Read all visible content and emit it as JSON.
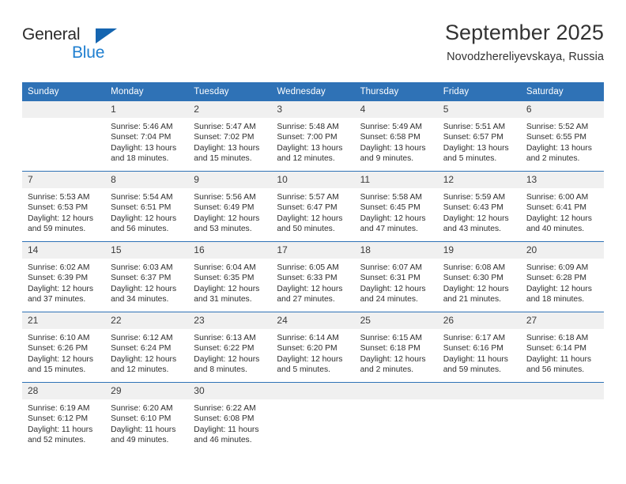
{
  "brand": {
    "name_part1": "General",
    "name_part2": "Blue",
    "triangle_color": "#1565b0",
    "blue_text_color": "#1f7fd0"
  },
  "header": {
    "title": "September 2025",
    "subtitle": "Novodzhereliyevskaya, Russia"
  },
  "theme": {
    "header_blue": "#2f72b6",
    "daynum_background": "#f0f0f0",
    "page_background": "#ffffff",
    "text_color": "#2e2e2e"
  },
  "weekdays": [
    "Sunday",
    "Monday",
    "Tuesday",
    "Wednesday",
    "Thursday",
    "Friday",
    "Saturday"
  ],
  "weeks": [
    [
      {
        "day": "",
        "sunrise": "",
        "sunset": "",
        "daylight1": "",
        "daylight2": ""
      },
      {
        "day": "1",
        "sunrise": "Sunrise: 5:46 AM",
        "sunset": "Sunset: 7:04 PM",
        "daylight1": "Daylight: 13 hours",
        "daylight2": "and 18 minutes."
      },
      {
        "day": "2",
        "sunrise": "Sunrise: 5:47 AM",
        "sunset": "Sunset: 7:02 PM",
        "daylight1": "Daylight: 13 hours",
        "daylight2": "and 15 minutes."
      },
      {
        "day": "3",
        "sunrise": "Sunrise: 5:48 AM",
        "sunset": "Sunset: 7:00 PM",
        "daylight1": "Daylight: 13 hours",
        "daylight2": "and 12 minutes."
      },
      {
        "day": "4",
        "sunrise": "Sunrise: 5:49 AM",
        "sunset": "Sunset: 6:58 PM",
        "daylight1": "Daylight: 13 hours",
        "daylight2": "and 9 minutes."
      },
      {
        "day": "5",
        "sunrise": "Sunrise: 5:51 AM",
        "sunset": "Sunset: 6:57 PM",
        "daylight1": "Daylight: 13 hours",
        "daylight2": "and 5 minutes."
      },
      {
        "day": "6",
        "sunrise": "Sunrise: 5:52 AM",
        "sunset": "Sunset: 6:55 PM",
        "daylight1": "Daylight: 13 hours",
        "daylight2": "and 2 minutes."
      }
    ],
    [
      {
        "day": "7",
        "sunrise": "Sunrise: 5:53 AM",
        "sunset": "Sunset: 6:53 PM",
        "daylight1": "Daylight: 12 hours",
        "daylight2": "and 59 minutes."
      },
      {
        "day": "8",
        "sunrise": "Sunrise: 5:54 AM",
        "sunset": "Sunset: 6:51 PM",
        "daylight1": "Daylight: 12 hours",
        "daylight2": "and 56 minutes."
      },
      {
        "day": "9",
        "sunrise": "Sunrise: 5:56 AM",
        "sunset": "Sunset: 6:49 PM",
        "daylight1": "Daylight: 12 hours",
        "daylight2": "and 53 minutes."
      },
      {
        "day": "10",
        "sunrise": "Sunrise: 5:57 AM",
        "sunset": "Sunset: 6:47 PM",
        "daylight1": "Daylight: 12 hours",
        "daylight2": "and 50 minutes."
      },
      {
        "day": "11",
        "sunrise": "Sunrise: 5:58 AM",
        "sunset": "Sunset: 6:45 PM",
        "daylight1": "Daylight: 12 hours",
        "daylight2": "and 47 minutes."
      },
      {
        "day": "12",
        "sunrise": "Sunrise: 5:59 AM",
        "sunset": "Sunset: 6:43 PM",
        "daylight1": "Daylight: 12 hours",
        "daylight2": "and 43 minutes."
      },
      {
        "day": "13",
        "sunrise": "Sunrise: 6:00 AM",
        "sunset": "Sunset: 6:41 PM",
        "daylight1": "Daylight: 12 hours",
        "daylight2": "and 40 minutes."
      }
    ],
    [
      {
        "day": "14",
        "sunrise": "Sunrise: 6:02 AM",
        "sunset": "Sunset: 6:39 PM",
        "daylight1": "Daylight: 12 hours",
        "daylight2": "and 37 minutes."
      },
      {
        "day": "15",
        "sunrise": "Sunrise: 6:03 AM",
        "sunset": "Sunset: 6:37 PM",
        "daylight1": "Daylight: 12 hours",
        "daylight2": "and 34 minutes."
      },
      {
        "day": "16",
        "sunrise": "Sunrise: 6:04 AM",
        "sunset": "Sunset: 6:35 PM",
        "daylight1": "Daylight: 12 hours",
        "daylight2": "and 31 minutes."
      },
      {
        "day": "17",
        "sunrise": "Sunrise: 6:05 AM",
        "sunset": "Sunset: 6:33 PM",
        "daylight1": "Daylight: 12 hours",
        "daylight2": "and 27 minutes."
      },
      {
        "day": "18",
        "sunrise": "Sunrise: 6:07 AM",
        "sunset": "Sunset: 6:31 PM",
        "daylight1": "Daylight: 12 hours",
        "daylight2": "and 24 minutes."
      },
      {
        "day": "19",
        "sunrise": "Sunrise: 6:08 AM",
        "sunset": "Sunset: 6:30 PM",
        "daylight1": "Daylight: 12 hours",
        "daylight2": "and 21 minutes."
      },
      {
        "day": "20",
        "sunrise": "Sunrise: 6:09 AM",
        "sunset": "Sunset: 6:28 PM",
        "daylight1": "Daylight: 12 hours",
        "daylight2": "and 18 minutes."
      }
    ],
    [
      {
        "day": "21",
        "sunrise": "Sunrise: 6:10 AM",
        "sunset": "Sunset: 6:26 PM",
        "daylight1": "Daylight: 12 hours",
        "daylight2": "and 15 minutes."
      },
      {
        "day": "22",
        "sunrise": "Sunrise: 6:12 AM",
        "sunset": "Sunset: 6:24 PM",
        "daylight1": "Daylight: 12 hours",
        "daylight2": "and 12 minutes."
      },
      {
        "day": "23",
        "sunrise": "Sunrise: 6:13 AM",
        "sunset": "Sunset: 6:22 PM",
        "daylight1": "Daylight: 12 hours",
        "daylight2": "and 8 minutes."
      },
      {
        "day": "24",
        "sunrise": "Sunrise: 6:14 AM",
        "sunset": "Sunset: 6:20 PM",
        "daylight1": "Daylight: 12 hours",
        "daylight2": "and 5 minutes."
      },
      {
        "day": "25",
        "sunrise": "Sunrise: 6:15 AM",
        "sunset": "Sunset: 6:18 PM",
        "daylight1": "Daylight: 12 hours",
        "daylight2": "and 2 minutes."
      },
      {
        "day": "26",
        "sunrise": "Sunrise: 6:17 AM",
        "sunset": "Sunset: 6:16 PM",
        "daylight1": "Daylight: 11 hours",
        "daylight2": "and 59 minutes."
      },
      {
        "day": "27",
        "sunrise": "Sunrise: 6:18 AM",
        "sunset": "Sunset: 6:14 PM",
        "daylight1": "Daylight: 11 hours",
        "daylight2": "and 56 minutes."
      }
    ],
    [
      {
        "day": "28",
        "sunrise": "Sunrise: 6:19 AM",
        "sunset": "Sunset: 6:12 PM",
        "daylight1": "Daylight: 11 hours",
        "daylight2": "and 52 minutes."
      },
      {
        "day": "29",
        "sunrise": "Sunrise: 6:20 AM",
        "sunset": "Sunset: 6:10 PM",
        "daylight1": "Daylight: 11 hours",
        "daylight2": "and 49 minutes."
      },
      {
        "day": "30",
        "sunrise": "Sunrise: 6:22 AM",
        "sunset": "Sunset: 6:08 PM",
        "daylight1": "Daylight: 11 hours",
        "daylight2": "and 46 minutes."
      },
      {
        "day": "",
        "sunrise": "",
        "sunset": "",
        "daylight1": "",
        "daylight2": ""
      },
      {
        "day": "",
        "sunrise": "",
        "sunset": "",
        "daylight1": "",
        "daylight2": ""
      },
      {
        "day": "",
        "sunrise": "",
        "sunset": "",
        "daylight1": "",
        "daylight2": ""
      },
      {
        "day": "",
        "sunrise": "",
        "sunset": "",
        "daylight1": "",
        "daylight2": ""
      }
    ]
  ]
}
